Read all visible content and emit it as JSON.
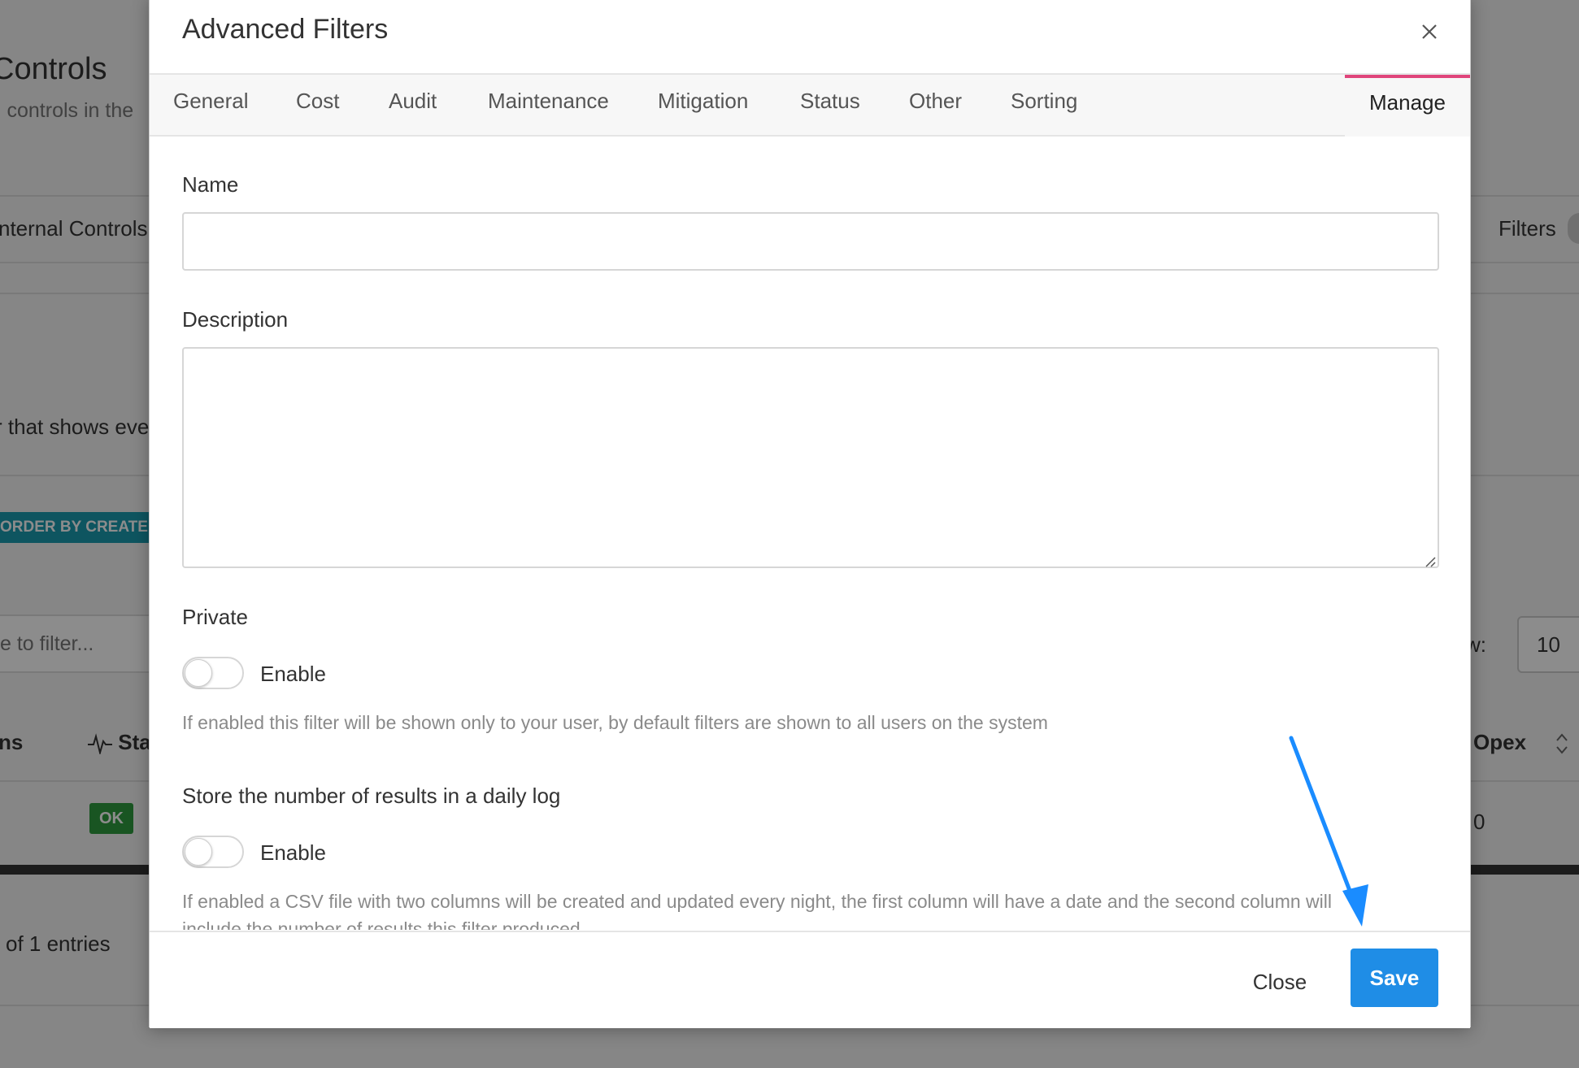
{
  "background": {
    "title": "Controls",
    "subtitle": "l controls in the",
    "tab": "nternal Controls",
    "filters_label": "Filters",
    "info_text": "r that shows eve",
    "order_button": "ORDER BY CREATE",
    "search_placeholder": "e to filter...",
    "show_label": "w:",
    "show_value": "10",
    "table_headers": [
      "ns",
      "Sta",
      "Opex"
    ],
    "status_badge": "OK",
    "opex_value": "0",
    "entries_text": "l of 1 entries"
  },
  "modal": {
    "title": "Advanced Filters",
    "tabs": [
      "General",
      "Cost",
      "Audit",
      "Maintenance",
      "Mitigation",
      "Status",
      "Other",
      "Sorting",
      "Manage"
    ],
    "active_tab": "Manage",
    "name_label": "Name",
    "name_value": "",
    "description_label": "Description",
    "description_value": "",
    "private": {
      "label": "Private",
      "toggle_label": "Enable",
      "enabled": false,
      "help": "If enabled this filter will be shown only to your user, by default filters are shown to all users on the system"
    },
    "daily_log": {
      "label": "Store the number of results in a daily log",
      "toggle_label": "Enable",
      "enabled": false,
      "help": "If enabled a CSV file with two columns will be created and updated every night, the first column will have a date and the second column will",
      "help_cut": "include the number of results this filter produced"
    },
    "footer": {
      "close_label": "Close",
      "save_label": "Save"
    }
  },
  "colors": {
    "accent": "#1f8de6",
    "active_tab_border": "#e0457b",
    "annotation_arrow": "#1a8cff",
    "ok_badge": "#2e9c3f",
    "order_button": "#1a9bb0"
  }
}
